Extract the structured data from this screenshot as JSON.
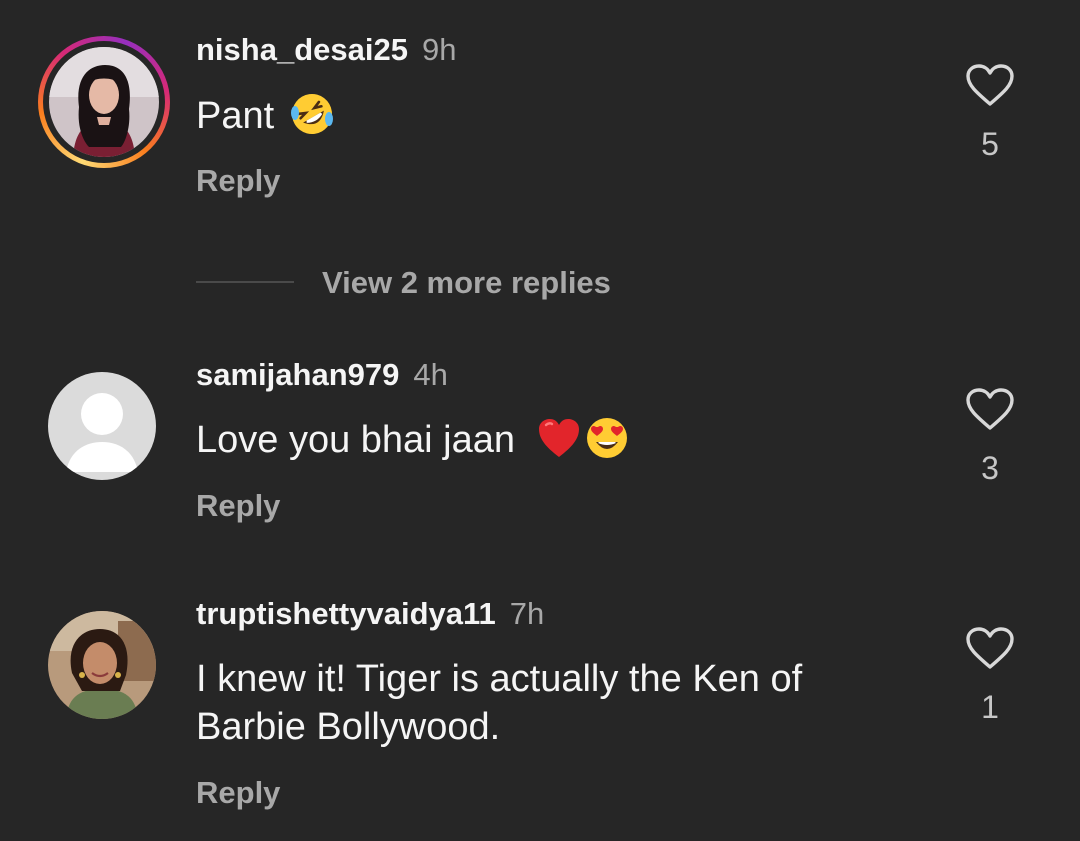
{
  "comments": [
    {
      "username": "nisha_desai25",
      "time": "9h",
      "text": "Pant",
      "emojis": [
        "rolling-on-floor-laughing-emoji"
      ],
      "reply_label": "Reply",
      "likes": "5",
      "has_story_ring": true
    },
    {
      "username": "samijahan979",
      "time": "4h",
      "text": "Love you bhai jaan",
      "emojis": [
        "red-heart-emoji",
        "heart-eyes-emoji"
      ],
      "reply_label": "Reply",
      "likes": "3",
      "has_story_ring": false
    },
    {
      "username": "truptishettyvaidya11",
      "time": "7h",
      "text_line1": "I knew it! Tiger is actually the Ken of",
      "text_line2": "Barbie Bollywood.",
      "reply_label": "Reply",
      "likes": "1",
      "has_story_ring": false
    }
  ],
  "view_more_replies": "View 2 more replies",
  "colors": {
    "background": "#262626",
    "primary_text": "#f5f5f5",
    "secondary_text": "#a8a8a8",
    "story_ring_gradient": [
      "#feda75",
      "#fa7e1e",
      "#d62976",
      "#962fbf"
    ]
  },
  "icons": {
    "like": "heart-outline-icon",
    "default_avatar": "default-user-avatar"
  }
}
